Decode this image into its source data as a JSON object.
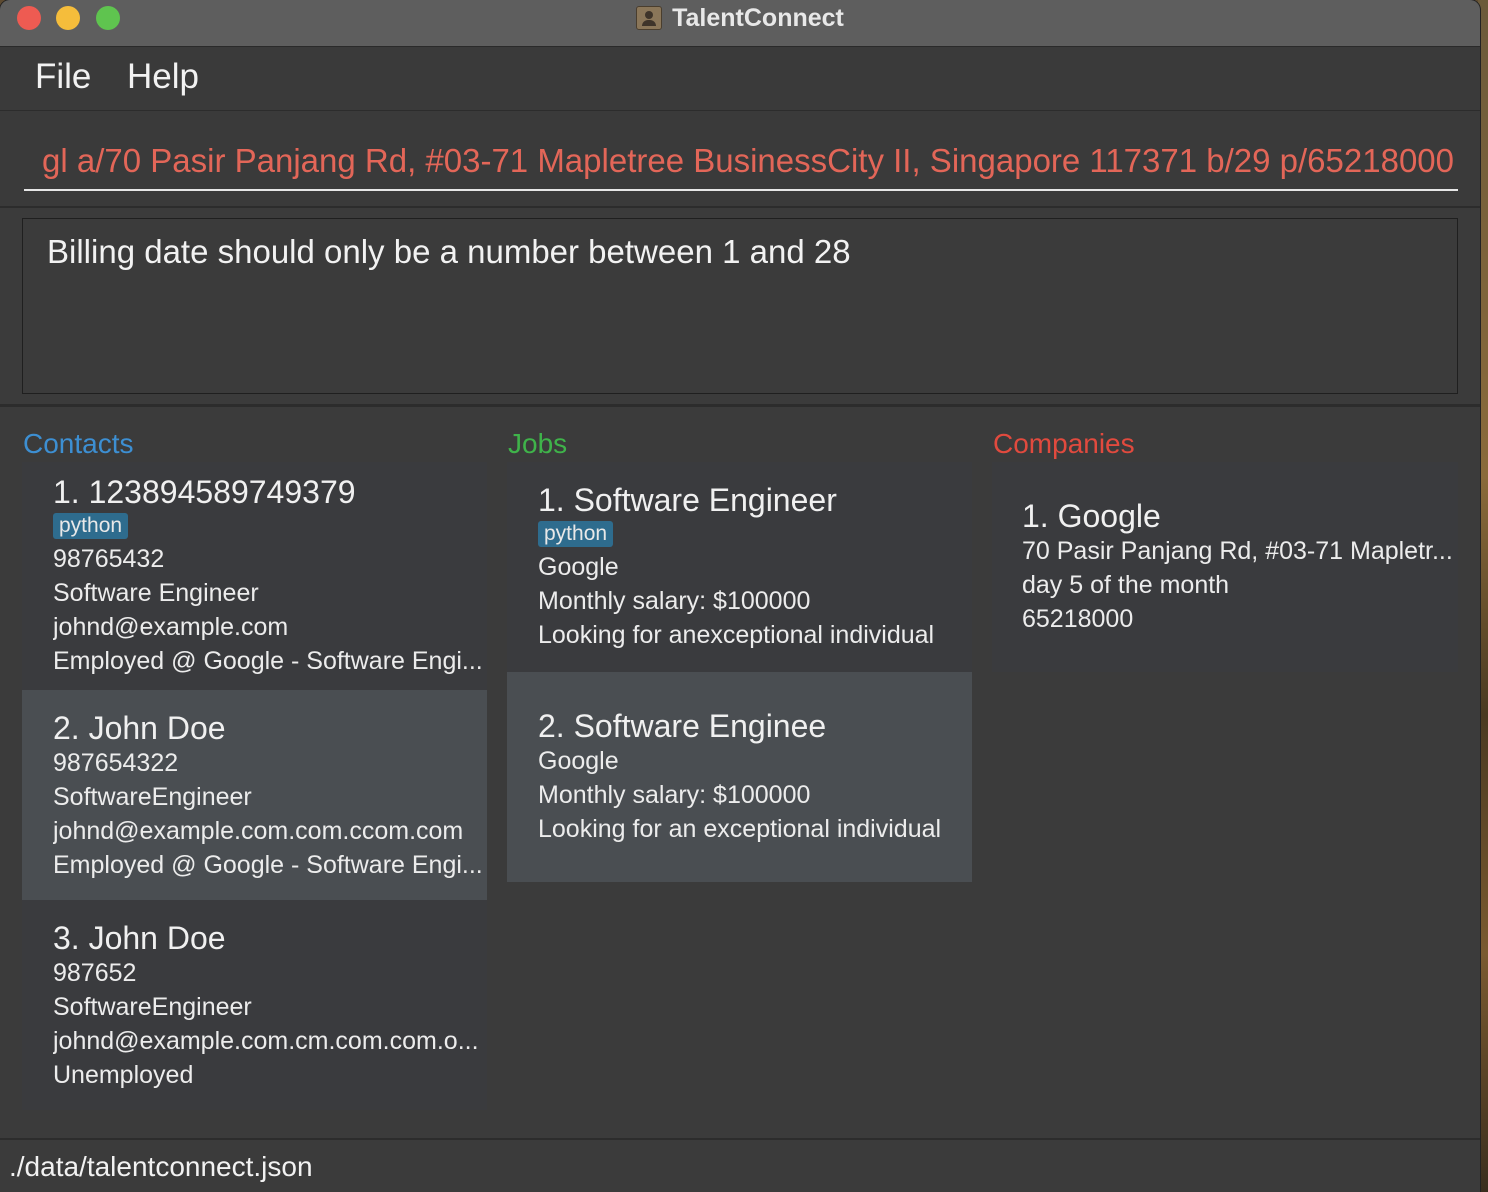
{
  "window": {
    "title": "TalentConnect"
  },
  "menu": {
    "file": "File",
    "help": "Help"
  },
  "command": {
    "value": "gl a/70 Pasir Panjang Rd, #03-71 Mapletree BusinessCity II, Singapore 117371 b/29 p/65218000"
  },
  "result": {
    "message": "Billing date should only be a number between 1 and 28"
  },
  "columns": {
    "contacts": "Contacts",
    "jobs": "Jobs",
    "companies": "Companies"
  },
  "contacts": [
    {
      "title": "1. 123894589749379",
      "tag": "python",
      "phone": "98765432",
      "role": "Software Engineer",
      "email": "johnd@example.com",
      "status": "Employed @ Google - Software Engi..."
    },
    {
      "title": "2. John Doe",
      "phone": "987654322",
      "role": "SoftwareEngineer",
      "email": "johnd@example.com.com.ccom.com",
      "status": "Employed @ Google - Software Engi..."
    },
    {
      "title": "3. John Doe",
      "phone": "987652",
      "role": "SoftwareEngineer",
      "email": "johnd@example.com.cm.com.com.o...",
      "status": "Unemployed"
    }
  ],
  "jobs": [
    {
      "title": "1. Software Engineer",
      "tag": "python",
      "company": "Google",
      "salary": "Monthly salary: $100000",
      "description": "Looking for anexceptional individual"
    },
    {
      "title": "2. Software Enginee",
      "company": "Google",
      "salary": "Monthly salary: $100000",
      "description": "Looking for an exceptional individual"
    }
  ],
  "companies": [
    {
      "title": "1. Google",
      "address": "70 Pasir Panjang Rd, #03-71 Mapletr...",
      "billing": "day 5 of the month",
      "phone": "65218000"
    }
  ],
  "status": {
    "path": "./data/talentconnect.json"
  }
}
